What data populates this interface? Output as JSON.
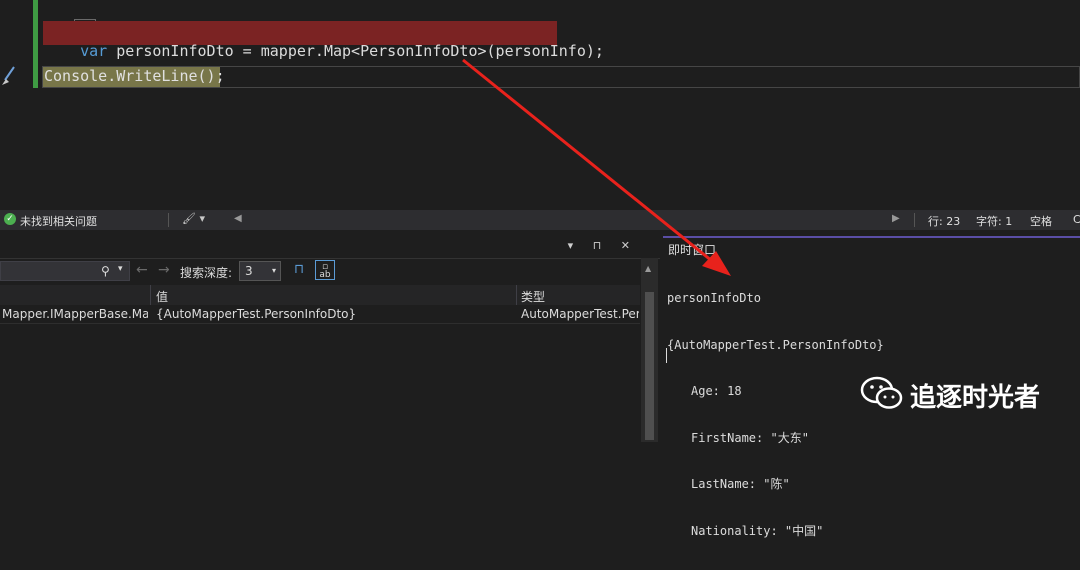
{
  "editor": {
    "brace_line": "};",
    "line1_keyword": "var",
    "line1_rest": " personInfoDto = mapper.Map<PersonInfoDto>(personInfo);",
    "line2": "Console.WriteLine();"
  },
  "status_bar": {
    "issues": "未找到相关问题",
    "line": "行: 23",
    "column": "字符: 1",
    "whitespace": "空格",
    "eol": "C"
  },
  "watch": {
    "search_depth_label": "搜索深度:",
    "search_depth_value": "3",
    "columns": {
      "value": "值",
      "type": "类型"
    },
    "rows": [
      {
        "name": "Mapper.IMapperBase.Ma...",
        "value": "{AutoMapperTest.PersonInfoDto}",
        "type": "AutoMapperTest.Per..."
      }
    ]
  },
  "immediate": {
    "title": "即时窗口",
    "lines": [
      "personInfoDto",
      "{AutoMapperTest.PersonInfoDto}",
      "Age: 18",
      "FirstName: \"大东\"",
      "LastName: \"陈\"",
      "Nationality: \"中国\""
    ]
  },
  "watermark": {
    "text": "追逐时光者"
  },
  "colors": {
    "arrow": "#e8221c",
    "highlight_red": "#7b2323",
    "accent_purple": "#5a4ea5"
  }
}
